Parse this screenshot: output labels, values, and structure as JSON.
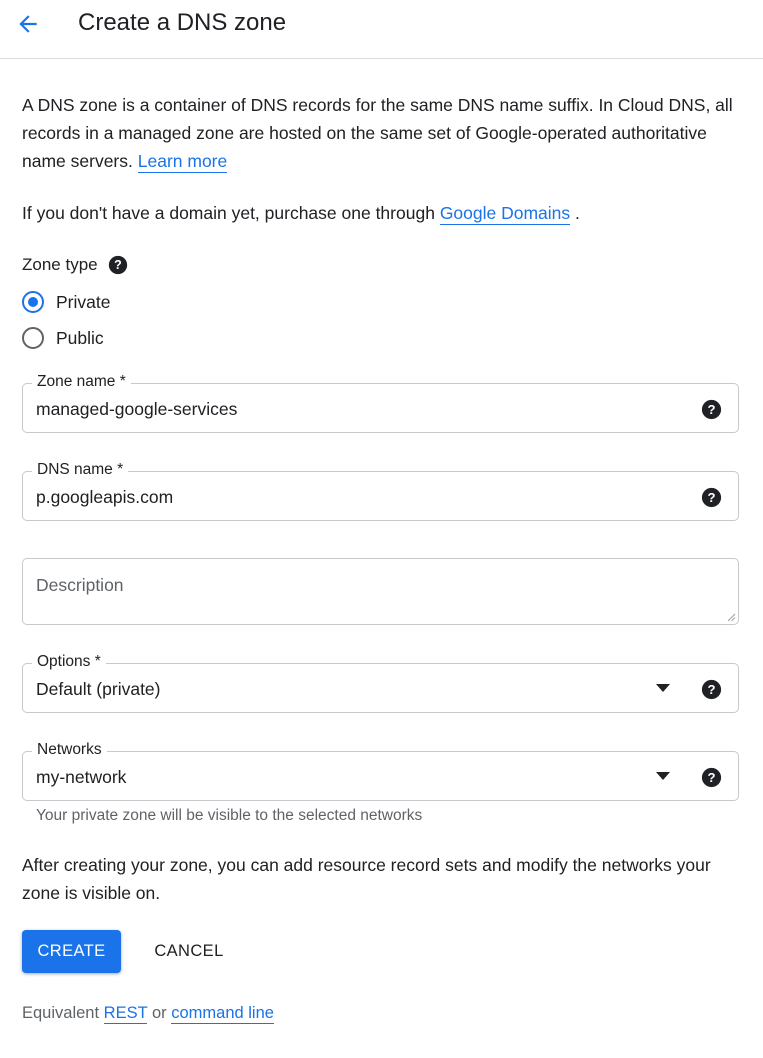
{
  "header": {
    "back_icon": "arrow-back-icon",
    "title": "Create a DNS zone"
  },
  "intro": {
    "text": "A DNS zone is a container of DNS records for the same DNS name suffix. In Cloud DNS, all records in a managed zone are hosted on the same set of Google-operated authoritative name servers.",
    "learn_more": "Learn more"
  },
  "purchase": {
    "prefix": "If you don't have a domain yet, purchase one through",
    "link": "Google Domains",
    "suffix": "."
  },
  "zone_type": {
    "label": "Zone type",
    "options": [
      {
        "label": "Private",
        "selected": true
      },
      {
        "label": "Public",
        "selected": false
      }
    ]
  },
  "zone_name": {
    "label": "Zone name *",
    "value": "managed-google-services"
  },
  "dns_name": {
    "label": "DNS name *",
    "value": "p.googleapis.com"
  },
  "description": {
    "placeholder": "Description"
  },
  "options_field": {
    "label": "Options *",
    "value": "Default (private)"
  },
  "networks": {
    "label": "Networks",
    "value": "my-network",
    "hint": "Your private zone will be visible to the selected networks"
  },
  "after_note": "After creating your zone, you can add resource record sets and modify the networks your zone is visible on.",
  "buttons": {
    "create": "CREATE",
    "cancel": "CANCEL"
  },
  "footer": {
    "prefix": "Equivalent",
    "rest_link": "REST",
    "middle": "or",
    "cli_link": "command line"
  },
  "colors": {
    "accent": "#1a73e8",
    "text": "#202124",
    "secondary_text": "#5f6368",
    "border": "#c7c9cc"
  }
}
